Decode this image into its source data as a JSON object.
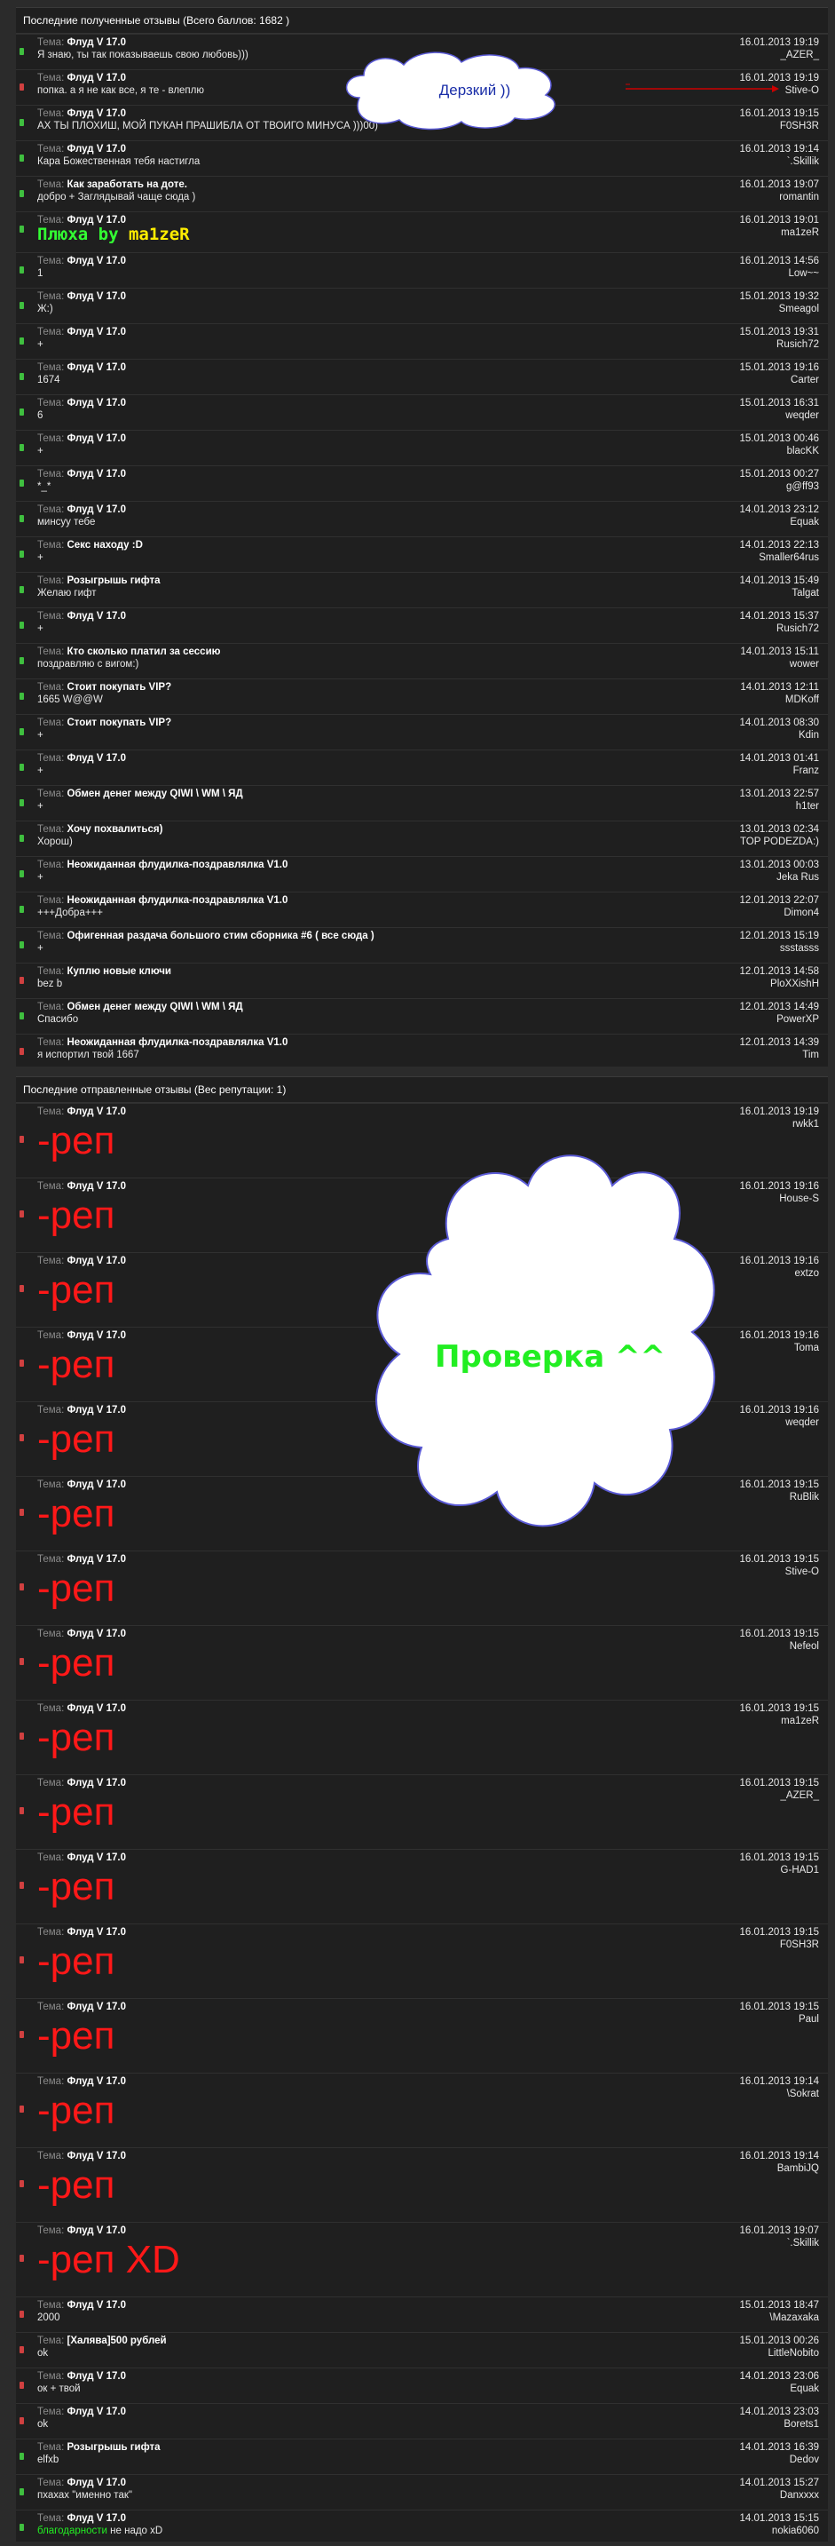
{
  "colors": {
    "positive": "#3fbf3f",
    "negative": "#d04040",
    "rep": "#ff1818",
    "bubble_text_green": "#22ee22",
    "bubble_text_blue": "#1a2ea8",
    "arrow": "#cc0000"
  },
  "received": {
    "header": "Последние полученные отзывы (Всего баллов: 1682 )",
    "topic_label": "Тема:",
    "rows": [
      {
        "type": "positive",
        "topic": "Флуд V 17.0",
        "text": "Я знаю, ты так показываешь свою любовь)))",
        "date": "16.01.2013 19:19",
        "user": "_AZER_"
      },
      {
        "type": "negative",
        "topic": "Флуд V 17.0",
        "text": "попка. а я не как все, я те - влеплю",
        "date": "16.01.2013 19:19",
        "user": "Stive-O"
      },
      {
        "type": "positive",
        "topic": "Флуд V 17.0",
        "text": "АХ ТЫ ПЛОХИШ, МОЙ ПУКАН ПРАШИБЛА ОТ ТВОИГО МИНУСА )))00)",
        "date": "16.01.2013 19:15",
        "user": "F0SH3R"
      },
      {
        "type": "positive",
        "topic": "Флуд V 17.0",
        "text": "Кара Божественная тебя настигла",
        "date": "16.01.2013 19:14",
        "user": "`.Skillik"
      },
      {
        "type": "positive",
        "topic": "Как заработать на доте.",
        "text": "добро + Заглядывай чаще сюда )",
        "date": "16.01.2013 19:07",
        "user": "romantin"
      },
      {
        "type": "positive",
        "topic": "Флуд V 17.0",
        "text": "",
        "fancy_a": "Плюха by ",
        "fancy_b": "ma1zeR",
        "date": "16.01.2013 19:01",
        "user": "ma1zeR"
      },
      {
        "type": "positive",
        "topic": "Флуд V 17.0",
        "text": "1",
        "date": "16.01.2013 14:56",
        "user": "Low~~"
      },
      {
        "type": "positive",
        "topic": "Флуд V 17.0",
        "text": "Ж:)",
        "date": "15.01.2013 19:32",
        "user": "Smeagol"
      },
      {
        "type": "positive",
        "topic": "Флуд V 17.0",
        "text": "+",
        "date": "15.01.2013 19:31",
        "user": "Rusich72"
      },
      {
        "type": "positive",
        "topic": "Флуд V 17.0",
        "text": "1674",
        "date": "15.01.2013 19:16",
        "user": "Carter"
      },
      {
        "type": "positive",
        "topic": "Флуд V 17.0",
        "text": "6",
        "date": "15.01.2013 16:31",
        "user": "weqder"
      },
      {
        "type": "positive",
        "topic": "Флуд V 17.0",
        "text": "+",
        "date": "15.01.2013 00:46",
        "user": "blacKK"
      },
      {
        "type": "positive",
        "topic": "Флуд V 17.0",
        "text": "*_*",
        "date": "15.01.2013 00:27",
        "user": "g@ff93"
      },
      {
        "type": "positive",
        "topic": "Флуд V 17.0",
        "text": "минсуу тебе",
        "date": "14.01.2013 23:12",
        "user": "Equak"
      },
      {
        "type": "positive",
        "topic": "Секс находу :D",
        "text": "+",
        "date": "14.01.2013 22:13",
        "user": "Smaller64rus"
      },
      {
        "type": "positive",
        "topic": "Розыгрышь гифта",
        "text": "Желаю гифт",
        "date": "14.01.2013 15:49",
        "user": "Talgat"
      },
      {
        "type": "positive",
        "topic": "Флуд V 17.0",
        "text": "+",
        "date": "14.01.2013 15:37",
        "user": "Rusich72"
      },
      {
        "type": "positive",
        "topic": "Кто сколько платил за сессию",
        "text": "поздравляю с вигом:)",
        "date": "14.01.2013 15:11",
        "user": "wower"
      },
      {
        "type": "positive",
        "topic": "Стоит покупать VIP?",
        "text": "1665 W@@W",
        "date": "14.01.2013 12:11",
        "user": "MDKoff"
      },
      {
        "type": "positive",
        "topic": "Стоит покупать VIP?",
        "text": "+",
        "date": "14.01.2013 08:30",
        "user": "Kdin"
      },
      {
        "type": "positive",
        "topic": "Флуд V 17.0",
        "text": "+",
        "date": "14.01.2013 01:41",
        "user": "Franz"
      },
      {
        "type": "positive",
        "topic": "Обмен денег между QIWI \\ WM \\ ЯД",
        "text": "+",
        "date": "13.01.2013 22:57",
        "user": "h1ter"
      },
      {
        "type": "positive",
        "topic": "Хочу похвалиться)",
        "text": "Хорош)",
        "date": "13.01.2013 02:34",
        "user": "TOP PODEZDA:)"
      },
      {
        "type": "positive",
        "topic": "Неожиданная флудилка-поздравлялка V1.0",
        "text": "+",
        "date": "13.01.2013 00:03",
        "user": "Jeka Rus"
      },
      {
        "type": "positive",
        "topic": "Неожиданная флудилка-поздравлялка V1.0",
        "text": "+++Добра+++",
        "date": "12.01.2013 22:07",
        "user": "Dimon4"
      },
      {
        "type": "positive",
        "topic": "Офигенная раздача большого стим сборника #6 ( все сюда )",
        "text": "+",
        "date": "12.01.2013 15:19",
        "user": "ssstasss"
      },
      {
        "type": "negative",
        "topic": "Куплю новые ключи",
        "text": "bez b",
        "date": "12.01.2013 14:58",
        "user": "PloXXishH"
      },
      {
        "type": "positive",
        "topic": "Обмен денег между QIWI \\ WM \\ ЯД",
        "text": "Спасибо",
        "date": "12.01.2013 14:49",
        "user": "PowerXP"
      },
      {
        "type": "negative",
        "topic": "Неожиданная флудилка-поздравлялка V1.0",
        "text": "я испортил твой 1667",
        "date": "12.01.2013 14:39",
        "user": "Tim"
      }
    ]
  },
  "sent": {
    "header": "Последние отправленные отзывы (Вес репутации: 1)",
    "topic_label": "Тема:",
    "rep_rows": [
      {
        "type": "negative",
        "topic": "Флуд V 17.0",
        "text": "-реп",
        "date": "16.01.2013 19:19",
        "user": "rwkk1"
      },
      {
        "type": "negative",
        "topic": "Флуд V 17.0",
        "text": "-реп",
        "date": "16.01.2013 19:16",
        "user": "House-S"
      },
      {
        "type": "negative",
        "topic": "Флуд V 17.0",
        "text": "-реп",
        "date": "16.01.2013 19:16",
        "user": "extzo"
      },
      {
        "type": "negative",
        "topic": "Флуд V 17.0",
        "text": "-реп",
        "date": "16.01.2013 19:16",
        "user": "Toma"
      },
      {
        "type": "negative",
        "topic": "Флуд V 17.0",
        "text": "-реп",
        "date": "16.01.2013 19:16",
        "user": "weqder"
      },
      {
        "type": "negative",
        "topic": "Флуд V 17.0",
        "text": "-реп",
        "date": "16.01.2013 19:15",
        "user": "RuBlik"
      },
      {
        "type": "negative",
        "topic": "Флуд V 17.0",
        "text": "-реп",
        "date": "16.01.2013 19:15",
        "user": "Stive-O"
      },
      {
        "type": "negative",
        "topic": "Флуд V 17.0",
        "text": "-реп",
        "date": "16.01.2013 19:15",
        "user": "Nefeol"
      },
      {
        "type": "negative",
        "topic": "Флуд V 17.0",
        "text": "-реп",
        "date": "16.01.2013 19:15",
        "user": "ma1zeR"
      },
      {
        "type": "negative",
        "topic": "Флуд V 17.0",
        "text": "-реп",
        "date": "16.01.2013 19:15",
        "user": "_AZER_"
      },
      {
        "type": "negative",
        "topic": "Флуд V 17.0",
        "text": "-реп",
        "date": "16.01.2013 19:15",
        "user": "G-HAD1"
      },
      {
        "type": "negative",
        "topic": "Флуд V 17.0",
        "text": "-реп",
        "date": "16.01.2013 19:15",
        "user": "F0SH3R"
      },
      {
        "type": "negative",
        "topic": "Флуд V 17.0",
        "text": "-реп",
        "date": "16.01.2013 19:15",
        "user": "Paul"
      },
      {
        "type": "negative",
        "topic": "Флуд V 17.0",
        "text": "-реп",
        "date": "16.01.2013 19:14",
        "user": "\\Sokrat"
      },
      {
        "type": "negative",
        "topic": "Флуд V 17.0",
        "text": "-реп",
        "date": "16.01.2013 19:14",
        "user": "BambiJQ"
      },
      {
        "type": "negative",
        "topic": "Флуд V 17.0",
        "text": "-реп XD",
        "date": "16.01.2013 19:07",
        "user": "`.Skillik"
      }
    ],
    "small_rows": [
      {
        "type": "negative",
        "topic": "Флуд V 17.0",
        "text": "2000",
        "date": "15.01.2013 18:47",
        "user": "\\Mazaxaka"
      },
      {
        "type": "negative",
        "topic": "[Халява]500 рублей",
        "text": "ok",
        "date": "15.01.2013 00:26",
        "user": "LittleNobito"
      },
      {
        "type": "negative",
        "topic": "Флуд V 17.0",
        "text": "ок + твой",
        "date": "14.01.2013 23:06",
        "user": "Equak"
      },
      {
        "type": "negative",
        "topic": "Флуд V 17.0",
        "text": "ok",
        "date": "14.01.2013 23:03",
        "user": "Borets1"
      },
      {
        "type": "positive",
        "topic": "Розыгрышь гифта",
        "text": "elfxb",
        "date": "14.01.2013 16:39",
        "user": "Dedov"
      },
      {
        "type": "positive",
        "topic": "Флуд V 17.0",
        "text": "пхахах \"именно так\"",
        "date": "14.01.2013 15:27",
        "user": "Danxxxx"
      },
      {
        "type": "positive",
        "topic": "Флуд V 17.0",
        "text": "",
        "green_text": "благодарности",
        "rest_text": " не надо xD",
        "date": "14.01.2013 15:15",
        "user": "nokia6060"
      }
    ]
  },
  "bubbles": {
    "top_text": "Дерзкий ))",
    "big_text": "Проверка ^^"
  }
}
